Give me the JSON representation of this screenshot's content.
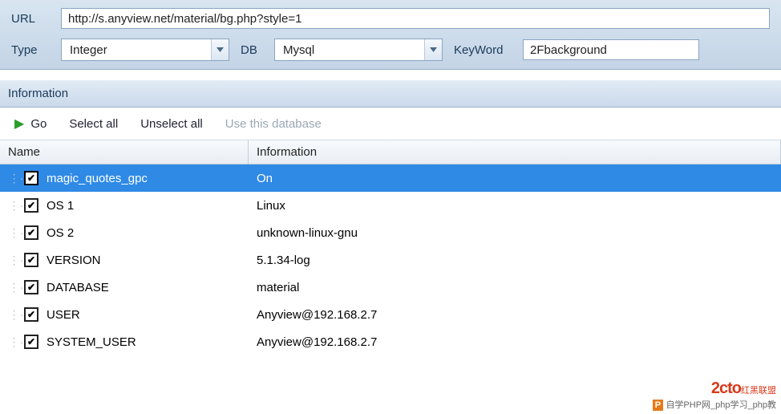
{
  "form": {
    "url_label": "URL",
    "url_value": "http://s.anyview.net/material/bg.php?style=1",
    "type_label": "Type",
    "type_value": "Integer",
    "db_label": "DB",
    "db_value": "Mysql",
    "keyword_label": "KeyWord",
    "keyword_value": "2Fbackground"
  },
  "panel_title": "Information",
  "toolbar": {
    "go": "Go",
    "select_all": "Select all",
    "unselect_all": "Unselect all",
    "use_db": "Use this database"
  },
  "columns": {
    "name": "Name",
    "info": "Information"
  },
  "rows": [
    {
      "name": "magic_quotes_gpc",
      "info": "On",
      "selected": true
    },
    {
      "name": "OS 1",
      "info": "Linux",
      "selected": false
    },
    {
      "name": "OS 2",
      "info": "unknown-linux-gnu",
      "selected": false
    },
    {
      "name": "VERSION",
      "info": "5.1.34-log",
      "selected": false
    },
    {
      "name": "DATABASE",
      "info": "material",
      "selected": false
    },
    {
      "name": "USER",
      "info": "Anyview@192.168.2.7",
      "selected": false
    },
    {
      "name": "SYSTEM_USER",
      "info": "Anyview@192.168.2.7",
      "selected": false
    }
  ],
  "watermark": {
    "logo": "2cto",
    "tag": "红黑联盟",
    "badge": "P",
    "sub": "自学PHP网_php学习_php教"
  }
}
